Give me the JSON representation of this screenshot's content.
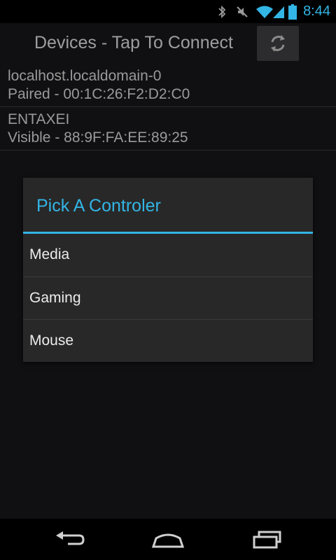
{
  "status_bar": {
    "time": "8:44",
    "icons": [
      "bluetooth-icon",
      "mute-icon",
      "wifi-icon",
      "signal-icon",
      "battery-icon"
    ],
    "accent": "#33b5e5"
  },
  "app": {
    "title": "Devices - Tap To Connect",
    "refresh_icon": "refresh-icon"
  },
  "devices": [
    {
      "name": "localhost.localdomain-0",
      "status": "Paired - 00:1C:26:F2:D2:C0"
    },
    {
      "name": "ENTAXEI",
      "status": "Visible - 88:9F:FA:EE:89:25"
    }
  ],
  "dialog": {
    "title": "Pick A Controler",
    "options": [
      "Media",
      "Gaming",
      "Mouse"
    ]
  },
  "nav": {
    "buttons": [
      "back-icon",
      "home-icon",
      "recent-apps-icon"
    ]
  },
  "colors": {
    "accent": "#33b5e5",
    "dialog_bg": "#282828",
    "app_bg": "#101012"
  }
}
